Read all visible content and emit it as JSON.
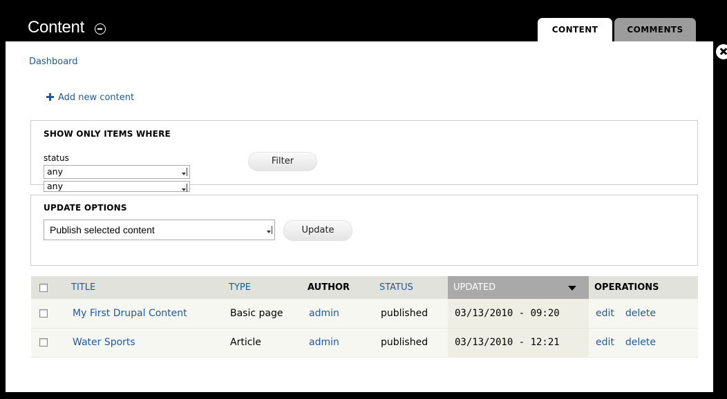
{
  "header": {
    "title": "Content",
    "tabs": [
      {
        "label": "CONTENT",
        "active": true
      },
      {
        "label": "COMMENTS",
        "active": false
      }
    ]
  },
  "breadcrumb": "Dashboard",
  "actions": {
    "add_content": "Add new content"
  },
  "filter": {
    "legend": "SHOW ONLY ITEMS WHERE",
    "status_label": "status",
    "status_value": "any",
    "second_value": "any",
    "button": "Filter"
  },
  "update": {
    "legend": "UPDATE OPTIONS",
    "operation": "Publish selected content",
    "button": "Update"
  },
  "table": {
    "headers": {
      "title": "TITLE",
      "type": "TYPE",
      "author": "AUTHOR",
      "status": "STATUS",
      "updated": "UPDATED",
      "operations": "OPERATIONS"
    },
    "rows": [
      {
        "title": "My First Drupal Content",
        "type": "Basic page",
        "author": "admin",
        "status": "published",
        "updated": "03/13/2010 - 09:20",
        "edit": "edit",
        "delete": "delete"
      },
      {
        "title": "Water Sports",
        "type": "Article",
        "author": "admin",
        "status": "published",
        "updated": "03/13/2010 - 12:21",
        "edit": "edit",
        "delete": "delete"
      }
    ]
  },
  "icons": [
    "collapse-icon",
    "overlay-close-icon",
    "plus-icon",
    "sort-descending-icon",
    "dropdown-arrow-icon"
  ],
  "colors": {
    "link": "#1c5aa5",
    "active_sort_header": "#a9a9a9",
    "header_bg": "#e1e2dc"
  }
}
